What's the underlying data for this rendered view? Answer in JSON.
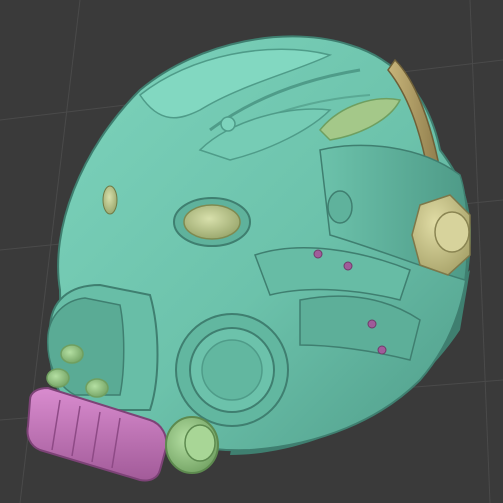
{
  "scene": {
    "subject": "helmet-sculpt",
    "colors": {
      "background": "#3a3a3a",
      "grid_line": "#4a4a4a",
      "shell": "#6fc7b0",
      "shell_shadow": "#4f9c89",
      "shell_dark": "#3f7f70",
      "eye_lens": "#c9d49a",
      "eye_lens_dark": "#9ca96f",
      "bolt_yellow": "#d2cf95",
      "rail_tan": "#b9a66c",
      "rail_tan_dark": "#8f7d4c",
      "filter_pink": "#c97abf",
      "filter_pink_dark": "#a25b99",
      "rivet_purple": "#a05c9a",
      "valve_green": "#9fd08d",
      "valve_green_dark": "#74a865"
    }
  }
}
